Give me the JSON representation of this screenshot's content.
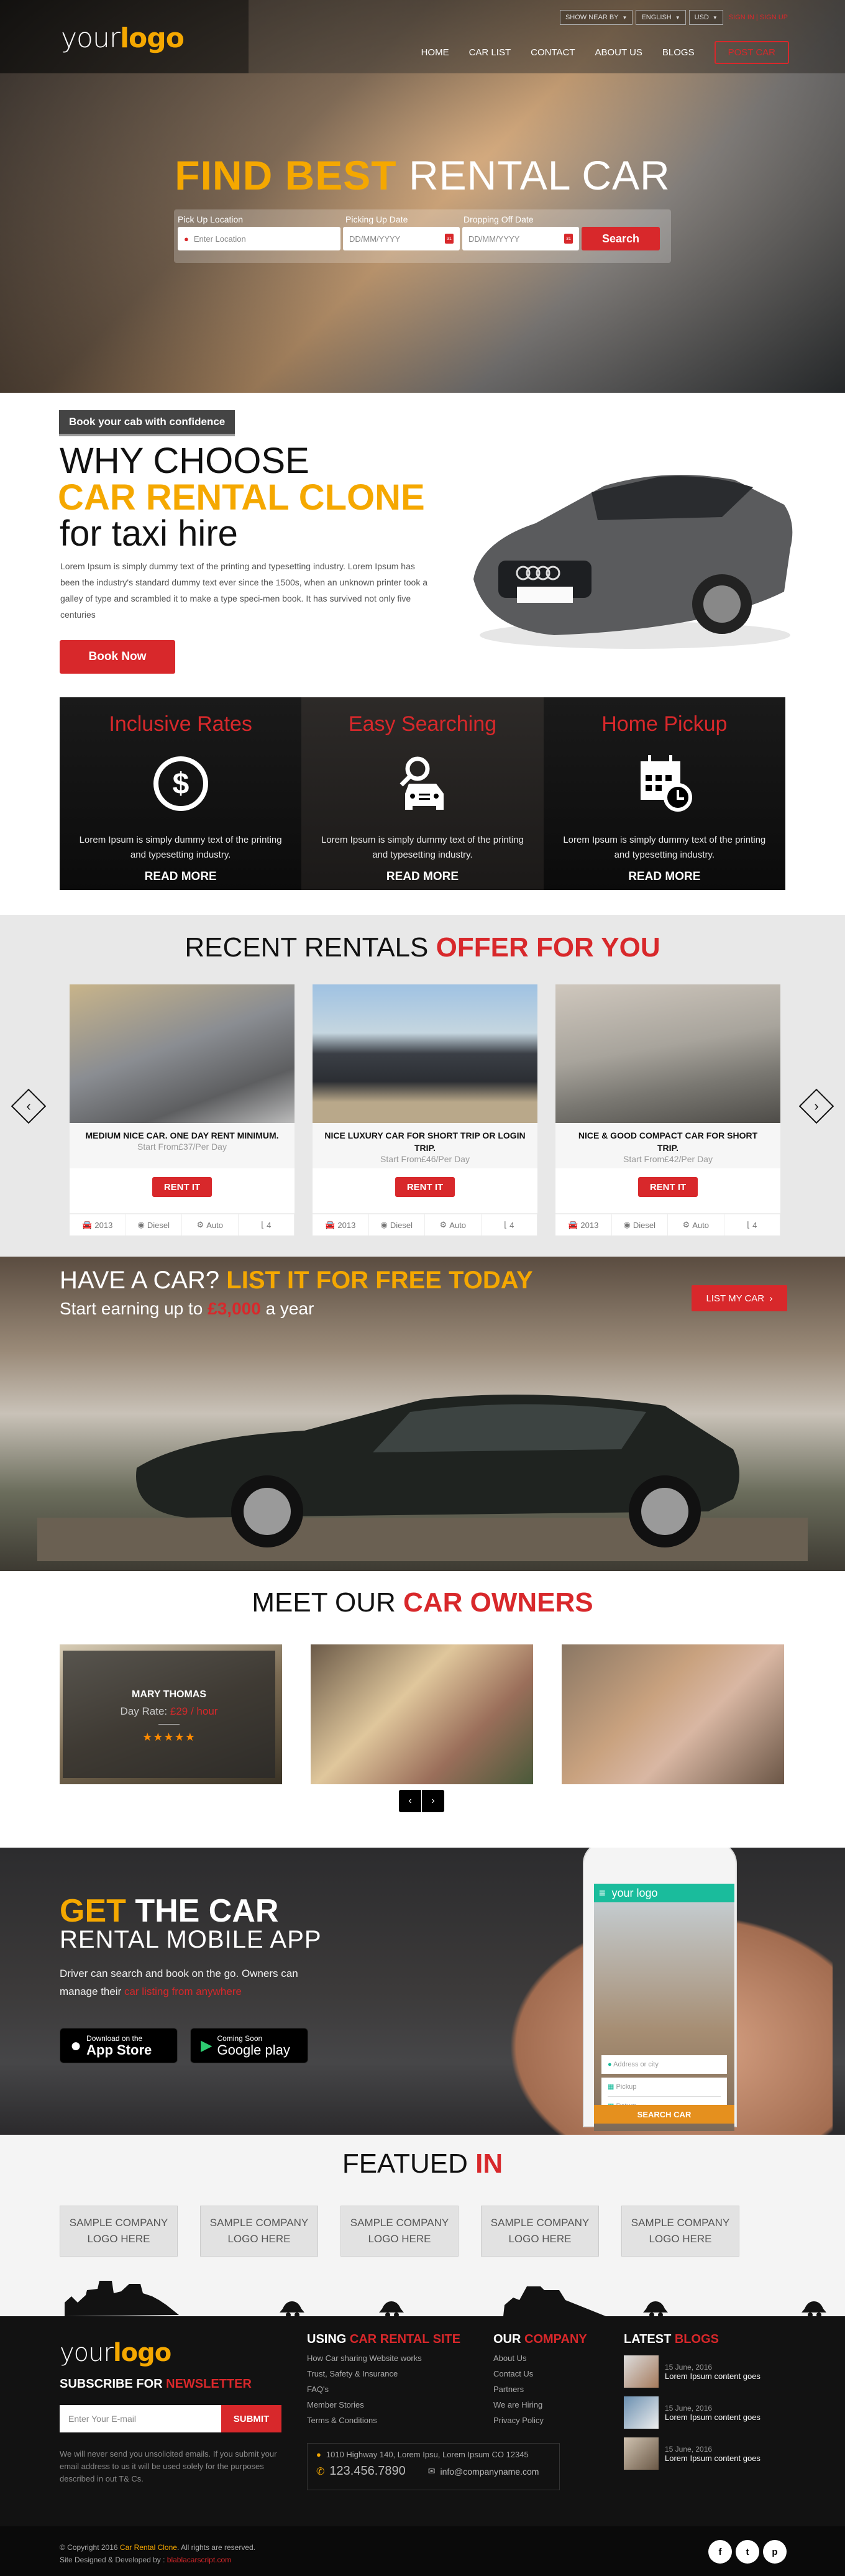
{
  "header": {
    "logo": {
      "part1": "your",
      "part2": "logo"
    },
    "topbar": {
      "show_near_by": "SHOW NEAR BY",
      "language": "ENGLISH",
      "currency": "USD",
      "sign_in": "SIGN IN",
      "separator": "|",
      "sign_up": "SIGN UP"
    },
    "nav": [
      "HOME",
      "CAR LIST",
      "CONTACT",
      "ABOUT US",
      "BLOGS"
    ],
    "post_car": "POST CAR"
  },
  "hero": {
    "title_highlight": "FIND BEST",
    "title_rest": "RENTAL CAR",
    "labels": {
      "pickup_location": "Pick Up Location",
      "pickup_date": "Picking Up Date",
      "dropoff_date": "Dropping Off Date"
    },
    "placeholders": {
      "location": "Enter Location",
      "pickup_date": "DD/MM/YYYY",
      "dropoff_date": "DD/MM/YYYY"
    },
    "calendar_day": "31",
    "search_button": "Search"
  },
  "why": {
    "badge": "Book your cab with confidence",
    "line1": "WHY CHOOSE",
    "line2": "CAR RENTAL CLONE",
    "line3": "for taxi hire",
    "paragraph": "Lorem Ipsum is simply dummy text of the printing and typesetting industry. Lorem Ipsum has been the industry's standard dummy text ever since the 1500s, when an unknown printer took a galley of type and scrambled it to make a type speci-men book. It has survived not only five centuries",
    "book_now": "Book Now",
    "features": [
      {
        "title": "Inclusive Rates",
        "icon": "dollar-icon",
        "text": "Lorem Ipsum is simply dummy text of the printing and typesetting industry.",
        "link": "READ MORE"
      },
      {
        "title": "Easy Searching",
        "icon": "car-search-icon",
        "text": "Lorem Ipsum is simply dummy text of the printing and typesetting industry.",
        "link": "READ MORE"
      },
      {
        "title": "Home Pickup",
        "icon": "calendar-clock-icon",
        "text": "Lorem Ipsum is simply dummy text of the printing and typesetting industry.",
        "link": "READ MORE"
      }
    ]
  },
  "rentals": {
    "title_light": "RECENT RENTALS",
    "title_bold": "OFFER FOR YOU",
    "prev": "‹",
    "next": "›",
    "cards": [
      {
        "title": "MEDIUM NICE CAR. ONE DAY RENT MINIMUM.",
        "price": "Start From£37/Per Day",
        "button": "RENT IT",
        "year": "2013",
        "fuel": "Diesel",
        "transmission": "Auto",
        "seats": "4",
        "color": "#8a8d92"
      },
      {
        "title": "NICE LUXURY CAR FOR SHORT TRIP OR LOGIN TRIP.",
        "price": "Start From£46/Per Day",
        "button": "RENT IT",
        "year": "2013",
        "fuel": "Diesel",
        "transmission": "Auto",
        "seats": "4",
        "color": "#3b3f46"
      },
      {
        "title": "NICE & GOOD COMPACT CAR FOR SHORT TRIP.",
        "price": "Start From£42/Per Day",
        "button": "RENT IT",
        "year": "2013",
        "fuel": "Diesel",
        "transmission": "Auto",
        "seats": "4",
        "color": "#a8a49c"
      }
    ]
  },
  "listcar": {
    "headline_light": "HAVE A CAR?",
    "headline_bold": "LIST IT FOR FREE TODAY",
    "sub_before": "Start earning up to",
    "sub_amount": "£3,000",
    "sub_after": "a year",
    "button": "LIST MY CAR",
    "button_arrow": "›"
  },
  "owners": {
    "title_light": "MEET OUR",
    "title_bold": "CAR OWNERS",
    "cards": [
      {
        "name": "MARY THOMAS",
        "rate_label": "Day Rate:",
        "rate_value": "£29 / hour",
        "rating": 5,
        "stars": "★★★★★"
      },
      {},
      {}
    ],
    "prev": "‹",
    "next": "›"
  },
  "app": {
    "title_highlight": "GET",
    "title_rest": "THE CAR",
    "subtitle": "RENTAL MOBILE APP",
    "text_before": "Driver can search and book on the go. Owners can manage their",
    "text_highlight": "car listing from anywhere",
    "appstore_small": "Download on the",
    "appstore_large": "App Store",
    "play_small": "Coming Soon",
    "play_large": "Google play",
    "phone": {
      "logo": "your logo",
      "address_placeholder": "Address or city",
      "pickup": "Pickup",
      "return": "Return",
      "search": "SEARCH CAR"
    }
  },
  "featured": {
    "title_light": "FEATUED",
    "title_bold": "IN",
    "logos": [
      {
        "line1": "SAMPLE COMPANY",
        "line2": "LOGO HERE"
      },
      {
        "line1": "SAMPLE COMPANY",
        "line2": "LOGO HERE"
      },
      {
        "line1": "SAMPLE COMPANY",
        "line2": "LOGO HERE"
      },
      {
        "line1": "SAMPLE COMPANY",
        "line2": "LOGO HERE"
      },
      {
        "line1": "SAMPLE COMPANY",
        "line2": "LOGO HERE"
      }
    ]
  },
  "footer": {
    "logo": {
      "part1": "your",
      "part2": "logo"
    },
    "newsletter": {
      "title_a": "SUBSCRIBE FOR",
      "title_b": "NEWSLETTER",
      "placeholder": "Enter Your E-mail",
      "submit": "SUBMIT",
      "note": "We will never send you unsolicited emails. If you submit your email address to us it will be used solely for the purposes described in out T& Cs."
    },
    "using": {
      "title_a": "USING",
      "title_b": "CAR RENTAL SITE",
      "links": [
        "How Car sharing Website works",
        "Trust, Safety & Insurance",
        "FAQ's",
        "Member Stories",
        "Terms & Conditions"
      ]
    },
    "company": {
      "title_a": "OUR",
      "title_b": "COMPANY",
      "links": [
        "About Us",
        "Contact Us",
        "Partners",
        "We are Hiring",
        "Privacy Policy"
      ]
    },
    "contact": {
      "address": "1010 Highway 140, Lorem Ipsu, Lorem Ipsum CO 12345",
      "phone": "123.456.7890",
      "email": "info@companyname.com"
    },
    "blogs": {
      "title_a": "LATEST",
      "title_b": "BLOGS",
      "posts": [
        {
          "date": "15 June, 2016",
          "title": "Lorem Ipsum content goes",
          "active": true
        },
        {
          "date": "15 June, 2016",
          "title": "Lorem Ipsum content goes",
          "active": false
        },
        {
          "date": "15 June, 2016",
          "title": "Lorem Ipsum content goes",
          "active": false
        }
      ]
    },
    "copyright_before": "© Copyright 2016",
    "copyright_brand": "Car Rental Clone",
    "copyright_after": ". All rights are reserved.",
    "designed_by": "Site Designed & Developed by :",
    "designed_link": "blablacarscript.com",
    "social": [
      {
        "name": "facebook",
        "glyph": "f"
      },
      {
        "name": "twitter",
        "glyph": "t"
      },
      {
        "name": "pinterest",
        "glyph": "p"
      }
    ]
  },
  "colors": {
    "accent_red": "#d8282b",
    "accent_yellow": "#f5a800",
    "dark": "#121212",
    "teal": "#1abc9c"
  }
}
